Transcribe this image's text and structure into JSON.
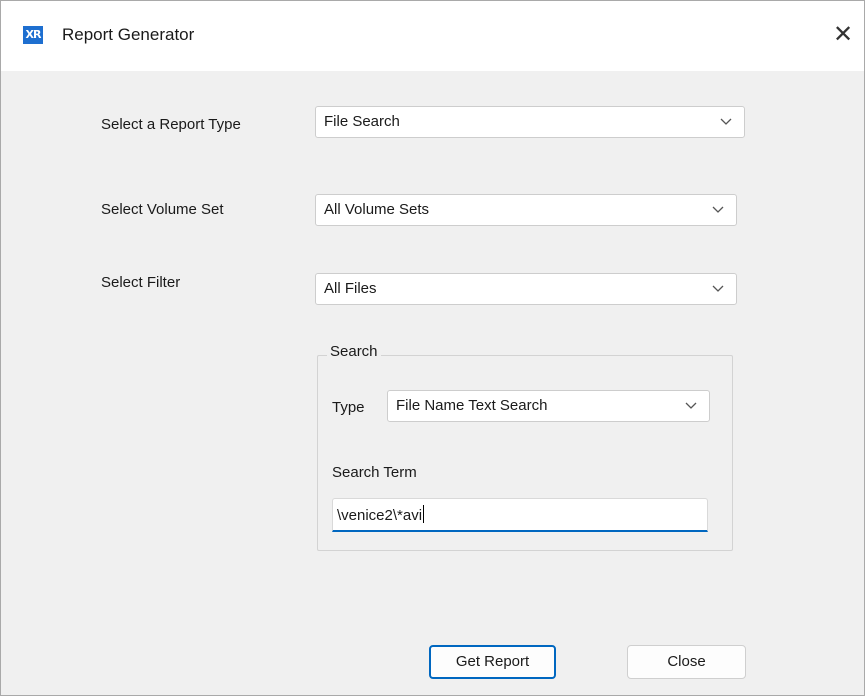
{
  "window": {
    "title": "Report Generator",
    "app_icon_text": "XR",
    "close_glyph": "✕"
  },
  "report_type": {
    "label": "Select a Report Type",
    "value": "File Search"
  },
  "volume_set": {
    "label": "Select Volume Set",
    "value": "All Volume Sets"
  },
  "filter": {
    "label": "Select Filter",
    "value": "All Files"
  },
  "search": {
    "group_title": "Search",
    "type_label": "Type",
    "type_value": "File Name Text Search",
    "term_label": "Search Term",
    "term_value": "\\venice2\\*avi"
  },
  "buttons": {
    "get_report": "Get Report",
    "close": "Close"
  },
  "colors": {
    "accent": "#0067c0",
    "app_icon": "#1e6fd0"
  },
  "icons": {
    "dropdown": "chevron-down-icon",
    "close": "close-icon"
  }
}
